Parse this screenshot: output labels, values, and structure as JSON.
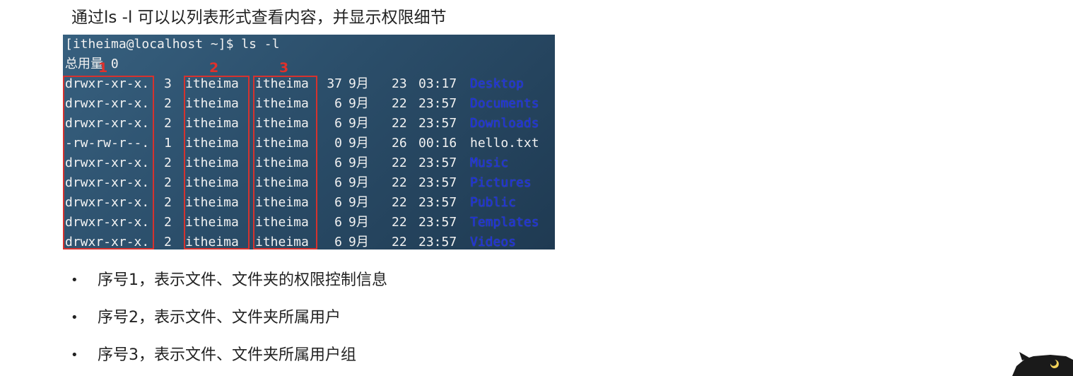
{
  "heading": "通过ls -l 可以以列表形式查看内容，并显示权限细节",
  "terminal": {
    "prompt": "[itheima@localhost ~]$ ls -l",
    "total": "总用量 0",
    "rows": [
      {
        "perm": "drwxr-xr-x.",
        "links": "3",
        "user": "itheima",
        "group": "itheima",
        "size": "37",
        "month": "9月",
        "day": "23",
        "time": "03:17",
        "name": "Desktop",
        "is_dir": true
      },
      {
        "perm": "drwxr-xr-x.",
        "links": "2",
        "user": "itheima",
        "group": "itheima",
        "size": "6",
        "month": "9月",
        "day": "22",
        "time": "23:57",
        "name": "Documents",
        "is_dir": true
      },
      {
        "perm": "drwxr-xr-x.",
        "links": "2",
        "user": "itheima",
        "group": "itheima",
        "size": "6",
        "month": "9月",
        "day": "22",
        "time": "23:57",
        "name": "Downloads",
        "is_dir": true
      },
      {
        "perm": "-rw-rw-r--.",
        "links": "1",
        "user": "itheima",
        "group": "itheima",
        "size": "0",
        "month": "9月",
        "day": "26",
        "time": "00:16",
        "name": "hello.txt",
        "is_dir": false
      },
      {
        "perm": "drwxr-xr-x.",
        "links": "2",
        "user": "itheima",
        "group": "itheima",
        "size": "6",
        "month": "9月",
        "day": "22",
        "time": "23:57",
        "name": "Music",
        "is_dir": true
      },
      {
        "perm": "drwxr-xr-x.",
        "links": "2",
        "user": "itheima",
        "group": "itheima",
        "size": "6",
        "month": "9月",
        "day": "22",
        "time": "23:57",
        "name": "Pictures",
        "is_dir": true
      },
      {
        "perm": "drwxr-xr-x.",
        "links": "2",
        "user": "itheima",
        "group": "itheima",
        "size": "6",
        "month": "9月",
        "day": "22",
        "time": "23:57",
        "name": "Public",
        "is_dir": true
      },
      {
        "perm": "drwxr-xr-x.",
        "links": "2",
        "user": "itheima",
        "group": "itheima",
        "size": "6",
        "month": "9月",
        "day": "22",
        "time": "23:57",
        "name": "Templates",
        "is_dir": true
      },
      {
        "perm": "drwxr-xr-x.",
        "links": "2",
        "user": "itheima",
        "group": "itheima",
        "size": "6",
        "month": "9月",
        "day": "22",
        "time": "23:57",
        "name": "Videos",
        "is_dir": true
      }
    ]
  },
  "markers": [
    "1",
    "2",
    "3"
  ],
  "bullets": [
    "序号1，表示文件、文件夹的权限控制信息",
    "序号2，表示文件、文件夹所属用户",
    "序号3，表示文件、文件夹所属用户组"
  ],
  "bullet_symbol": "•",
  "colors": {
    "highlight_box": "#d6322e",
    "directory_name": "#1b2cd8",
    "terminal_bg": "#2b4e6a"
  }
}
